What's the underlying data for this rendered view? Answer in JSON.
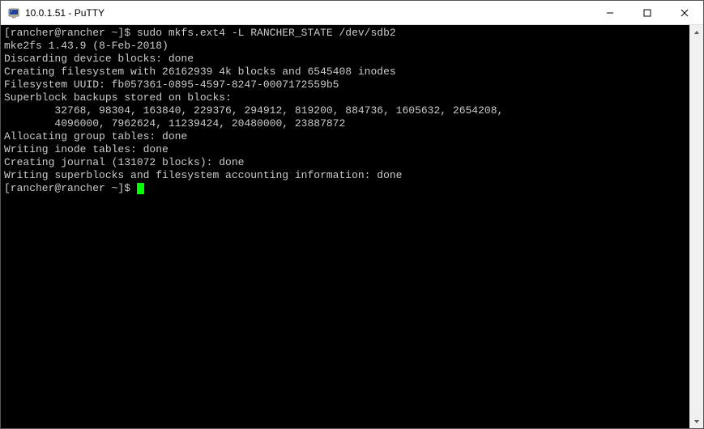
{
  "window": {
    "title": "10.0.1.51 - PuTTY"
  },
  "terminal": {
    "prompt": "[rancher@rancher ~]$ ",
    "command": "sudo mkfs.ext4 -L RANCHER_STATE /dev/sdb2",
    "lines": [
      "mke2fs 1.43.9 (8-Feb-2018)",
      "Discarding device blocks: done",
      "Creating filesystem with 26162939 4k blocks and 6545408 inodes",
      "Filesystem UUID: fb057361-0895-4597-8247-0007172559b5",
      "Superblock backups stored on blocks:",
      "        32768, 98304, 163840, 229376, 294912, 819200, 884736, 1605632, 2654208,",
      "        4096000, 7962624, 11239424, 20480000, 23887872",
      "",
      "Allocating group tables: done",
      "Writing inode tables: done",
      "Creating journal (131072 blocks): done",
      "Writing superblocks and filesystem accounting information: done",
      ""
    ],
    "prompt2": "[rancher@rancher ~]$ "
  }
}
